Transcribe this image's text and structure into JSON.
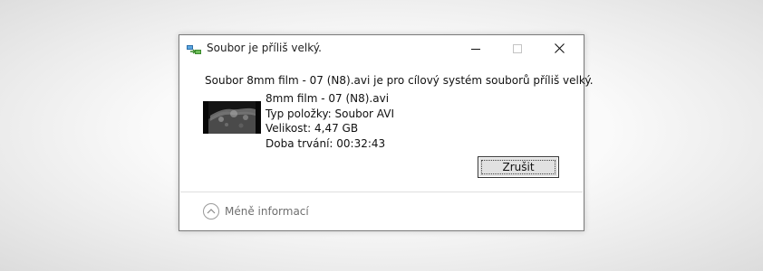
{
  "window": {
    "title": "Soubor je příliš velký.",
    "icon": "copy-transfer-icon",
    "controls": {
      "minimize": "minimize-icon",
      "maximize": "maximize-icon",
      "close": "close-icon"
    }
  },
  "message": "Soubor 8mm film - 07 (N8).avi je pro cílový systém souborů příliš velký.",
  "file": {
    "thumbnail": "video-thumbnail",
    "name": "8mm film - 07 (N8).avi",
    "type_line": "Typ položky: Soubor AVI",
    "size_line": "Velikost: 4,47 GB",
    "duration_line": "Doba trvání: 00:32:43"
  },
  "buttons": {
    "cancel_label": "Zrušit"
  },
  "footer": {
    "less_info_label": "Méně informací",
    "icon": "chevron-up-icon"
  }
}
